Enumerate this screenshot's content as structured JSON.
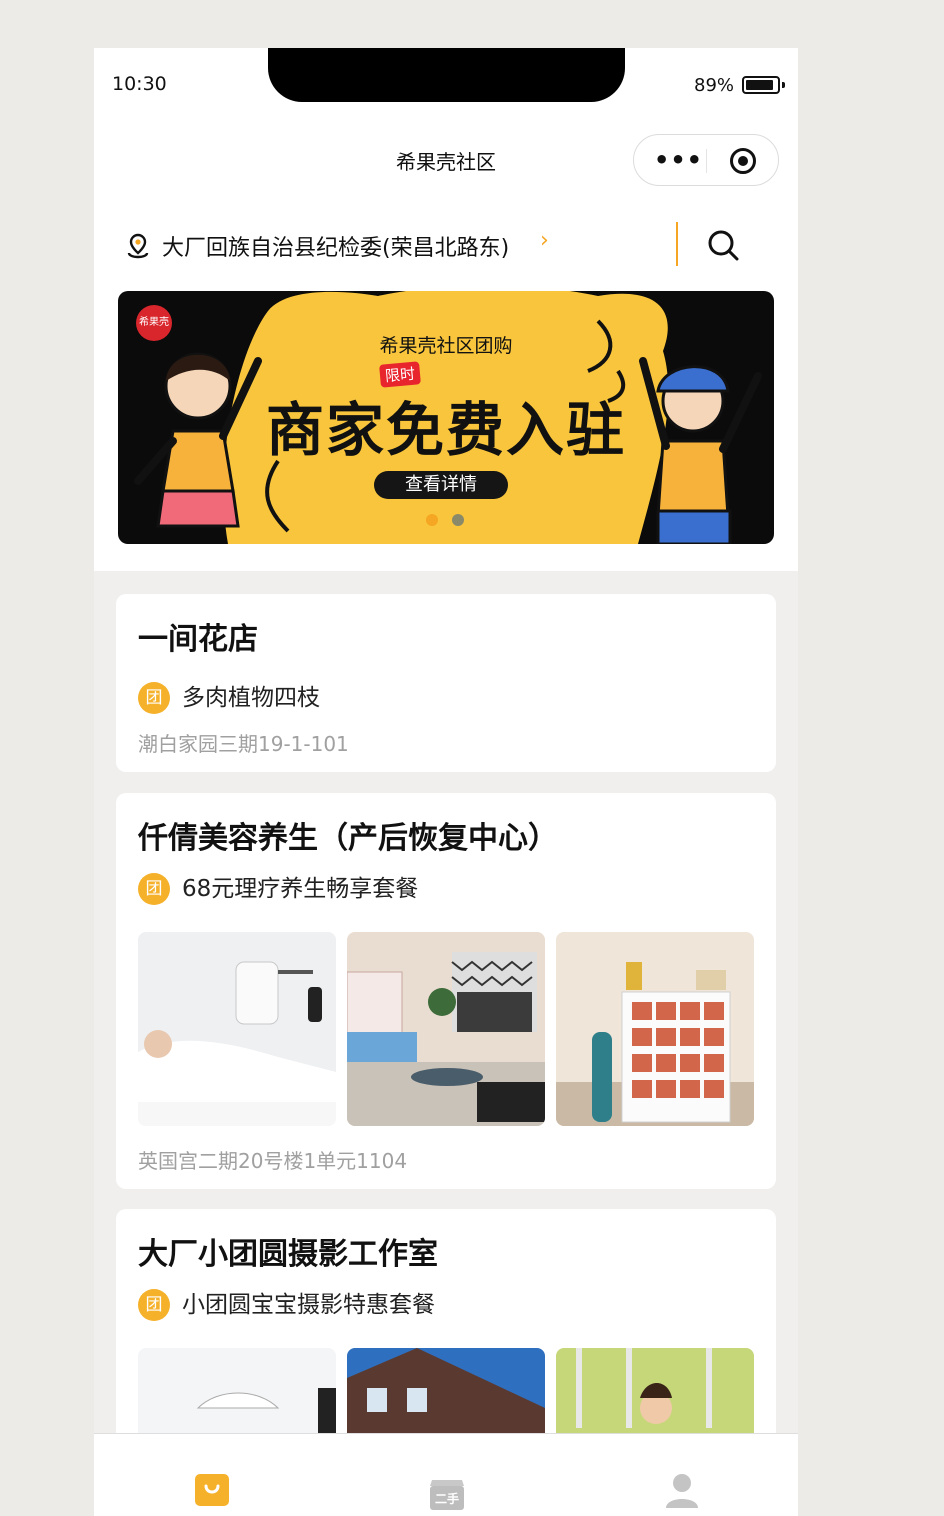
{
  "status_bar": {
    "time": "10:30",
    "battery": "89%",
    "battery_level": 0.89
  },
  "nav": {
    "title": "希果壳社区",
    "menu_icon": "more-dots-icon",
    "close_icon": "target-circle-icon"
  },
  "location": {
    "text": "大厂回族自治县纪检委(荣昌北路东)",
    "arrow": "›",
    "icon": "location-pin-icon",
    "search_icon": "search-icon"
  },
  "banner": {
    "logo": "希果壳",
    "subtitle": "希果壳社区团购",
    "tag": "限时",
    "headline": "商家免费入驻",
    "button": "查看详情",
    "slide_count": 2,
    "active_slide": 0,
    "colors": {
      "yellow": "#f8c53c",
      "dot_active": "#f5a623",
      "dot_inactive": "#8a8a6a"
    }
  },
  "shops": [
    {
      "name": "一间花店",
      "badge": "团",
      "deal": "多肉植物四枝",
      "address": "潮白家园三期19-1-101"
    },
    {
      "name": "仟倩美容养生（产后恢复中心）",
      "badge": "团",
      "deal": "68元理疗养生畅享套餐",
      "address": "英国宫二期20号楼1单元1104"
    },
    {
      "name": "大厂小团圆摄影工作室",
      "badge": "团",
      "deal": "小团圆宝宝摄影特惠套餐"
    }
  ],
  "tabbar": {
    "icons": [
      "shopping-bag-icon",
      "second-hand-icon",
      "user-icon"
    ],
    "second_hand_label": "二手"
  },
  "colors": {
    "accent": "#f5a623",
    "badge": "#f5b12a"
  }
}
